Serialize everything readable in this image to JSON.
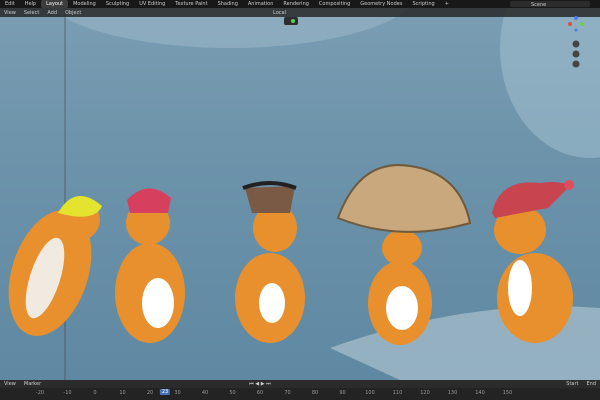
{
  "menu": [
    "Edit",
    "Help"
  ],
  "workspaces": [
    "Layout",
    "Modeling",
    "Sculpting",
    "UV Editing",
    "Texture Paint",
    "Shading",
    "Animation",
    "Rendering",
    "Compositing",
    "Geometry Nodes",
    "Scripting",
    "+"
  ],
  "active_workspace": "Layout",
  "scene": "Scene",
  "viewport_menu": [
    "View",
    "Select",
    "Add",
    "Object"
  ],
  "transform_orientation": "Local",
  "timeline_menu": [
    "View",
    "Marker"
  ],
  "timeline": {
    "current_frame": "23",
    "start_label": "Start",
    "end_label": "End",
    "ticks": [
      "-20",
      "-10",
      "0",
      "10",
      "20",
      "30",
      "40",
      "50",
      "60",
      "70",
      "80",
      "90",
      "100",
      "110",
      "120",
      "130",
      "140",
      "150"
    ]
  },
  "colors": {
    "accent": "#4772b3",
    "sky": "#6c93aa",
    "fur": "#e8902e"
  }
}
